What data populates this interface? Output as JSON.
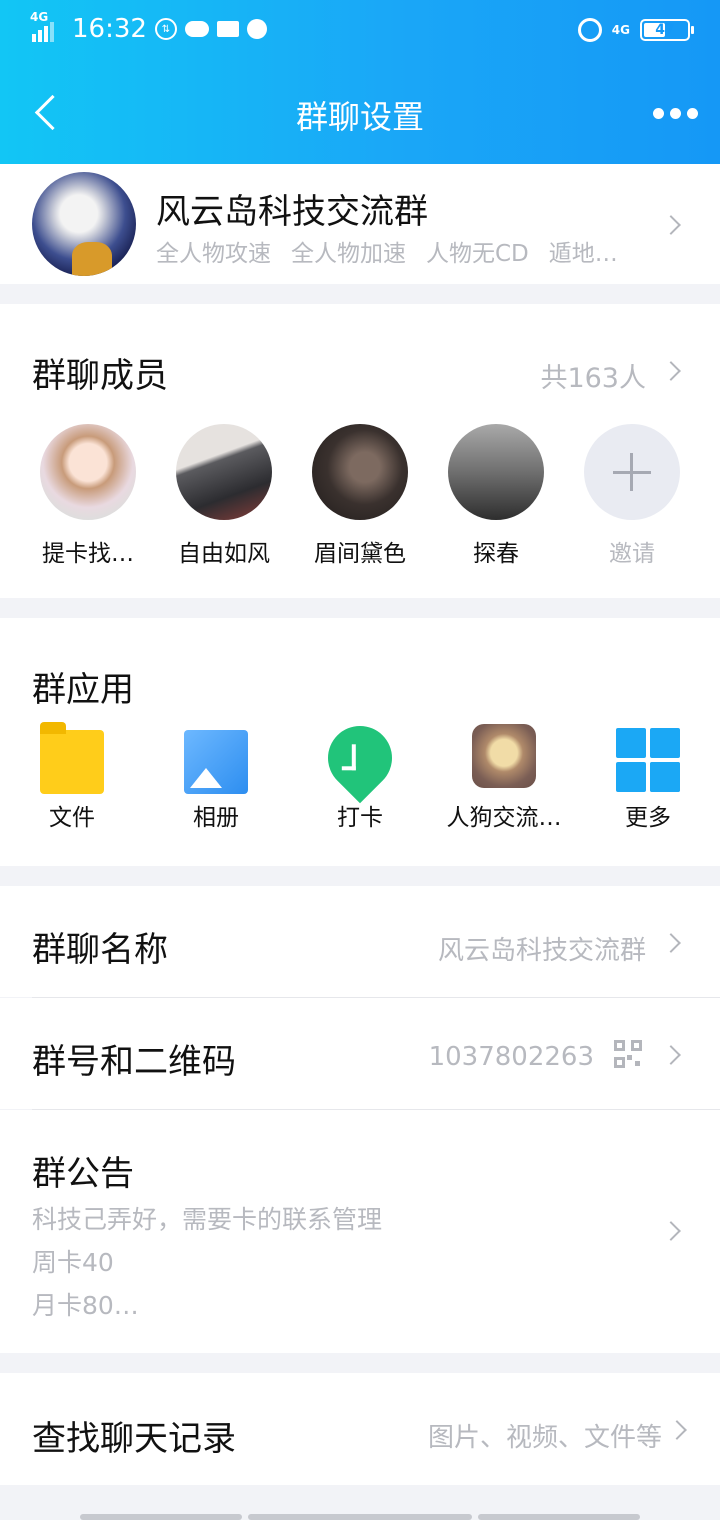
{
  "status_bar": {
    "network": "4G",
    "time": "16:32",
    "battery": "47",
    "right_network": "4G"
  },
  "header": {
    "title": "群聊设置"
  },
  "group": {
    "name": "风云岛科技交流群",
    "tags": [
      "全人物攻速",
      "全人物加速",
      "人物无CD",
      "遁地…"
    ]
  },
  "members": {
    "title": "群聊成员",
    "count": "共163人",
    "list": [
      {
        "name": "提卡找…"
      },
      {
        "name": "自由如风"
      },
      {
        "name": "眉间黛色"
      },
      {
        "name": "探春"
      }
    ],
    "invite_label": "邀请"
  },
  "apps": {
    "title": "群应用",
    "items": [
      {
        "label": "文件",
        "icon": "folder-icon"
      },
      {
        "label": "相册",
        "icon": "album-icon"
      },
      {
        "label": "打卡",
        "icon": "checkin-icon"
      },
      {
        "label": "人狗交流…",
        "icon": "dog-app-icon"
      },
      {
        "label": "更多",
        "icon": "grid-more-icon"
      }
    ]
  },
  "settings": {
    "group_name_label": "群聊名称",
    "group_name_value": "风云岛科技交流群",
    "group_number_label": "群号和二维码",
    "group_number_value": "1037802263",
    "notice_label": "群公告",
    "notice_lines": [
      "科技己弄好，需要卡的联系管理",
      "周卡40",
      "月卡80…"
    ],
    "search_label": "查找聊天记录",
    "search_value": "图片、视频、文件等"
  },
  "colors": {
    "header_start": "#12c6f5",
    "header_end": "#1598f6",
    "secondary_text": "#b7b9bf",
    "background": "#f2f3f7"
  }
}
